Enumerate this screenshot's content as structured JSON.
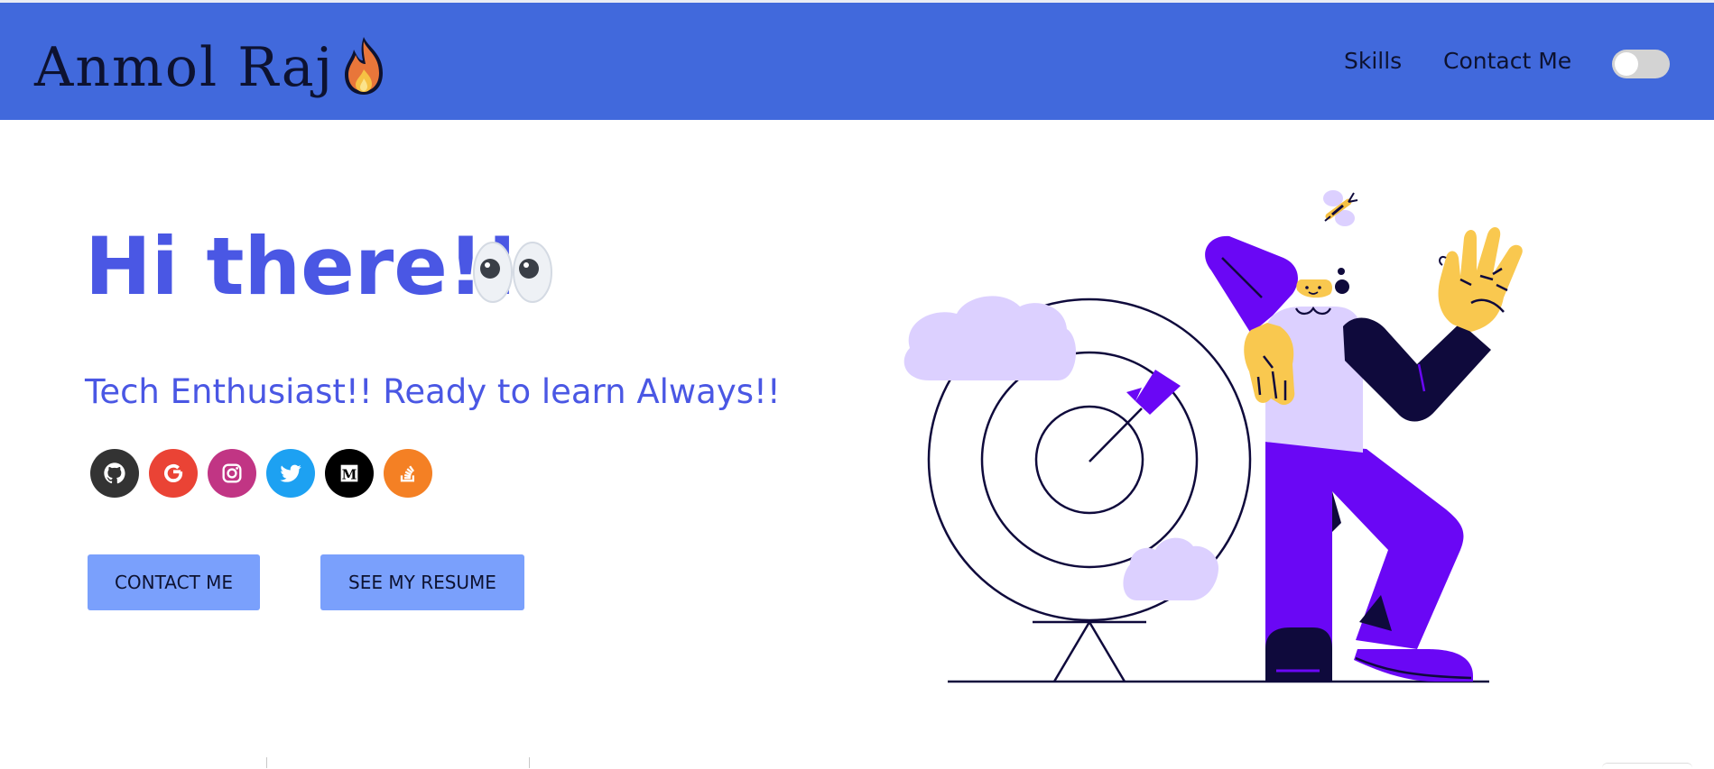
{
  "header": {
    "logo_text": "Anmol Raj",
    "logo_icon": "fire-emoji",
    "nav": [
      {
        "label": "Skills"
      },
      {
        "label": "Contact Me"
      }
    ],
    "theme_toggle": {
      "state": "off"
    },
    "background_color": "#4169dc"
  },
  "hero": {
    "title": "Hi there!!",
    "title_icon": "eyes-emoji",
    "subtitle": "Tech Enthusiast!! Ready to learn Always!!",
    "accent_color": "#4a57e4",
    "socials": [
      {
        "name": "github-icon",
        "color": "#333333"
      },
      {
        "name": "google-icon",
        "color": "#ea4335"
      },
      {
        "name": "instagram-icon",
        "color": "#c13584"
      },
      {
        "name": "twitter-icon",
        "color": "#1da1f2"
      },
      {
        "name": "medium-icon",
        "color": "#000000"
      },
      {
        "name": "stackoverflow-icon",
        "color": "#f48024"
      }
    ],
    "buttons": {
      "contact_label": "CONTACT ME",
      "resume_label": "SEE MY RESUME",
      "button_color": "#7aa0fc"
    },
    "illustration": "person-with-target-illustration"
  }
}
